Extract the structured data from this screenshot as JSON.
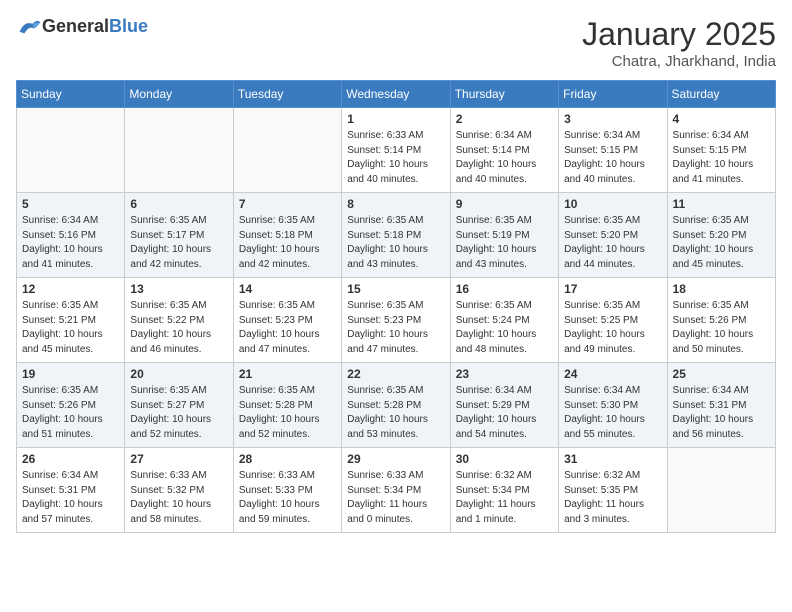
{
  "header": {
    "logo_general": "General",
    "logo_blue": "Blue",
    "month": "January 2025",
    "location": "Chatra, Jharkhand, India"
  },
  "weekdays": [
    "Sunday",
    "Monday",
    "Tuesday",
    "Wednesday",
    "Thursday",
    "Friday",
    "Saturday"
  ],
  "weeks": [
    [
      {
        "day": "",
        "info": ""
      },
      {
        "day": "",
        "info": ""
      },
      {
        "day": "",
        "info": ""
      },
      {
        "day": "1",
        "info": "Sunrise: 6:33 AM\nSunset: 5:14 PM\nDaylight: 10 hours\nand 40 minutes."
      },
      {
        "day": "2",
        "info": "Sunrise: 6:34 AM\nSunset: 5:14 PM\nDaylight: 10 hours\nand 40 minutes."
      },
      {
        "day": "3",
        "info": "Sunrise: 6:34 AM\nSunset: 5:15 PM\nDaylight: 10 hours\nand 40 minutes."
      },
      {
        "day": "4",
        "info": "Sunrise: 6:34 AM\nSunset: 5:15 PM\nDaylight: 10 hours\nand 41 minutes."
      }
    ],
    [
      {
        "day": "5",
        "info": "Sunrise: 6:34 AM\nSunset: 5:16 PM\nDaylight: 10 hours\nand 41 minutes."
      },
      {
        "day": "6",
        "info": "Sunrise: 6:35 AM\nSunset: 5:17 PM\nDaylight: 10 hours\nand 42 minutes."
      },
      {
        "day": "7",
        "info": "Sunrise: 6:35 AM\nSunset: 5:18 PM\nDaylight: 10 hours\nand 42 minutes."
      },
      {
        "day": "8",
        "info": "Sunrise: 6:35 AM\nSunset: 5:18 PM\nDaylight: 10 hours\nand 43 minutes."
      },
      {
        "day": "9",
        "info": "Sunrise: 6:35 AM\nSunset: 5:19 PM\nDaylight: 10 hours\nand 43 minutes."
      },
      {
        "day": "10",
        "info": "Sunrise: 6:35 AM\nSunset: 5:20 PM\nDaylight: 10 hours\nand 44 minutes."
      },
      {
        "day": "11",
        "info": "Sunrise: 6:35 AM\nSunset: 5:20 PM\nDaylight: 10 hours\nand 45 minutes."
      }
    ],
    [
      {
        "day": "12",
        "info": "Sunrise: 6:35 AM\nSunset: 5:21 PM\nDaylight: 10 hours\nand 45 minutes."
      },
      {
        "day": "13",
        "info": "Sunrise: 6:35 AM\nSunset: 5:22 PM\nDaylight: 10 hours\nand 46 minutes."
      },
      {
        "day": "14",
        "info": "Sunrise: 6:35 AM\nSunset: 5:23 PM\nDaylight: 10 hours\nand 47 minutes."
      },
      {
        "day": "15",
        "info": "Sunrise: 6:35 AM\nSunset: 5:23 PM\nDaylight: 10 hours\nand 47 minutes."
      },
      {
        "day": "16",
        "info": "Sunrise: 6:35 AM\nSunset: 5:24 PM\nDaylight: 10 hours\nand 48 minutes."
      },
      {
        "day": "17",
        "info": "Sunrise: 6:35 AM\nSunset: 5:25 PM\nDaylight: 10 hours\nand 49 minutes."
      },
      {
        "day": "18",
        "info": "Sunrise: 6:35 AM\nSunset: 5:26 PM\nDaylight: 10 hours\nand 50 minutes."
      }
    ],
    [
      {
        "day": "19",
        "info": "Sunrise: 6:35 AM\nSunset: 5:26 PM\nDaylight: 10 hours\nand 51 minutes."
      },
      {
        "day": "20",
        "info": "Sunrise: 6:35 AM\nSunset: 5:27 PM\nDaylight: 10 hours\nand 52 minutes."
      },
      {
        "day": "21",
        "info": "Sunrise: 6:35 AM\nSunset: 5:28 PM\nDaylight: 10 hours\nand 52 minutes."
      },
      {
        "day": "22",
        "info": "Sunrise: 6:35 AM\nSunset: 5:28 PM\nDaylight: 10 hours\nand 53 minutes."
      },
      {
        "day": "23",
        "info": "Sunrise: 6:34 AM\nSunset: 5:29 PM\nDaylight: 10 hours\nand 54 minutes."
      },
      {
        "day": "24",
        "info": "Sunrise: 6:34 AM\nSunset: 5:30 PM\nDaylight: 10 hours\nand 55 minutes."
      },
      {
        "day": "25",
        "info": "Sunrise: 6:34 AM\nSunset: 5:31 PM\nDaylight: 10 hours\nand 56 minutes."
      }
    ],
    [
      {
        "day": "26",
        "info": "Sunrise: 6:34 AM\nSunset: 5:31 PM\nDaylight: 10 hours\nand 57 minutes."
      },
      {
        "day": "27",
        "info": "Sunrise: 6:33 AM\nSunset: 5:32 PM\nDaylight: 10 hours\nand 58 minutes."
      },
      {
        "day": "28",
        "info": "Sunrise: 6:33 AM\nSunset: 5:33 PM\nDaylight: 10 hours\nand 59 minutes."
      },
      {
        "day": "29",
        "info": "Sunrise: 6:33 AM\nSunset: 5:34 PM\nDaylight: 11 hours\nand 0 minutes."
      },
      {
        "day": "30",
        "info": "Sunrise: 6:32 AM\nSunset: 5:34 PM\nDaylight: 11 hours\nand 1 minute."
      },
      {
        "day": "31",
        "info": "Sunrise: 6:32 AM\nSunset: 5:35 PM\nDaylight: 11 hours\nand 3 minutes."
      },
      {
        "day": "",
        "info": ""
      }
    ]
  ]
}
